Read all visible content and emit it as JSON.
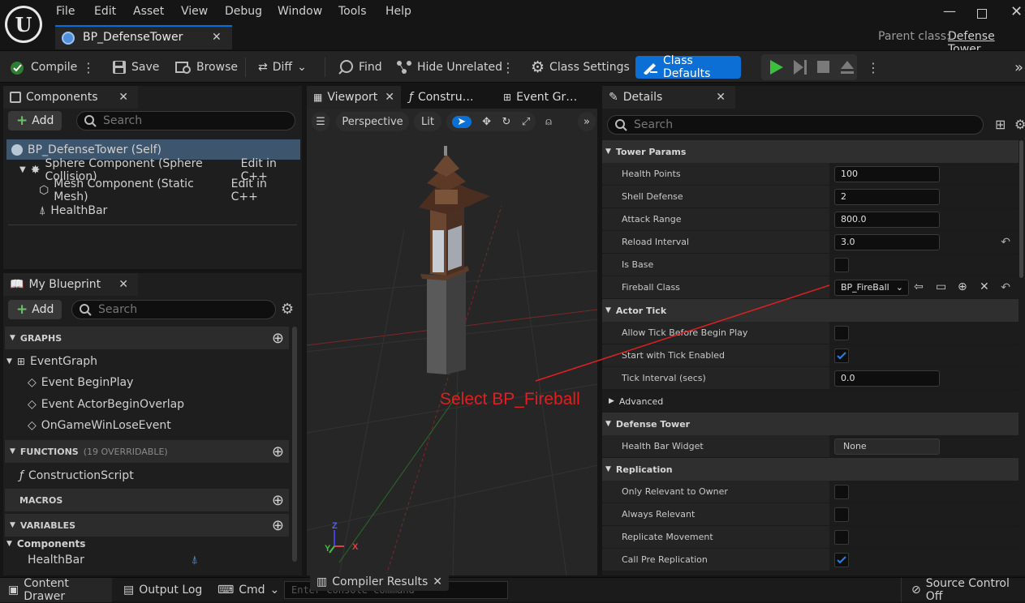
{
  "menu": [
    "File",
    "Edit",
    "Asset",
    "View",
    "Debug",
    "Window",
    "Tools",
    "Help"
  ],
  "asset_tab": {
    "label": "BP_DefenseTower"
  },
  "parent_class": {
    "label": "Parent class:",
    "value": "Defense Tower"
  },
  "toolbar": {
    "compile": "Compile",
    "save": "Save",
    "browse": "Browse",
    "diff": "Diff",
    "find": "Find",
    "hide_unrelated": "Hide Unrelated",
    "class_settings": "Class Settings",
    "class_defaults": "Class Defaults"
  },
  "components": {
    "tab": "Components",
    "add": "Add",
    "search_placeholder": "Search",
    "tree": [
      {
        "label": "BP_DefenseTower (Self)"
      },
      {
        "label": "Sphere Component (Sphere Collision)",
        "action": "Edit in C++"
      },
      {
        "label": "Mesh Component (Static Mesh)",
        "action": "Edit in C++"
      },
      {
        "label": "HealthBar"
      }
    ]
  },
  "my_blueprint": {
    "tab": "My Blueprint",
    "add": "Add",
    "search_placeholder": "Search",
    "graphs_header": "GRAPHS",
    "event_graph": "EventGraph",
    "events": [
      "Event BeginPlay",
      "Event ActorBeginOverlap",
      "OnGameWinLoseEvent"
    ],
    "functions_header": "FUNCTIONS",
    "functions_note": "(19 OVERRIDABLE)",
    "functions": [
      "ConstructionScript"
    ],
    "macros_header": "MACROS",
    "variables_header": "VARIABLES",
    "var_category": "Components",
    "variables": [
      "HealthBar"
    ]
  },
  "viewport": {
    "tabs": [
      "Viewport",
      "Constru…",
      "Event Gr…"
    ],
    "perspective": "Perspective",
    "lit": "Lit",
    "axis": {
      "z": "Z",
      "y": "Y",
      "x": "X"
    }
  },
  "annotation": {
    "text": "Select BP_Fireball",
    "color": "#e02020"
  },
  "details": {
    "tab": "Details",
    "search_placeholder": "Search",
    "sections": [
      {
        "title": "Tower Params",
        "expanded": true,
        "rows": [
          {
            "label": "Health Points",
            "type": "number",
            "value": "100"
          },
          {
            "label": "Shell Defense",
            "type": "number",
            "value": "2"
          },
          {
            "label": "Attack Range",
            "type": "number",
            "value": "800.0"
          },
          {
            "label": "Reload Interval",
            "type": "number",
            "value": "3.0",
            "reset": true
          },
          {
            "label": "Is Base",
            "type": "check",
            "checked": false
          },
          {
            "label": "Fireball Class",
            "type": "class",
            "value": "BP_FireBall",
            "reset": true
          }
        ]
      },
      {
        "title": "Actor Tick",
        "expanded": true,
        "rows": [
          {
            "label": "Allow Tick Before Begin Play",
            "type": "check",
            "checked": false
          },
          {
            "label": "Start with Tick Enabled",
            "type": "check",
            "checked": true
          },
          {
            "label": "Tick Interval (secs)",
            "type": "number",
            "value": "0.0"
          }
        ]
      },
      {
        "title": "Advanced",
        "expanded": false,
        "sub": true,
        "rows": []
      },
      {
        "title": "Defense Tower",
        "expanded": true,
        "rows": [
          {
            "label": "Health Bar Widget",
            "type": "dropdown",
            "value": "None"
          }
        ]
      },
      {
        "title": "Replication",
        "expanded": true,
        "rows": [
          {
            "label": "Only Relevant to Owner",
            "type": "check",
            "checked": false
          },
          {
            "label": "Always Relevant",
            "type": "check",
            "checked": false
          },
          {
            "label": "Replicate Movement",
            "type": "check",
            "checked": false
          },
          {
            "label": "Call Pre Replication",
            "type": "check",
            "checked": true
          }
        ]
      }
    ]
  },
  "statusbar": {
    "content_drawer": "Content Drawer",
    "output_log": "Output Log",
    "cmd": "Cmd",
    "console_placeholder": "Enter Console Command",
    "compiler_results": "Compiler Results",
    "source_control": "Source Control Off"
  },
  "colors": {
    "accent": "#0070e0",
    "class_defaults_bg": "#0b6fd6",
    "play_green": "#3cbf3c",
    "check_blue": "#2a7bde",
    "annotation_red": "#e02020"
  }
}
